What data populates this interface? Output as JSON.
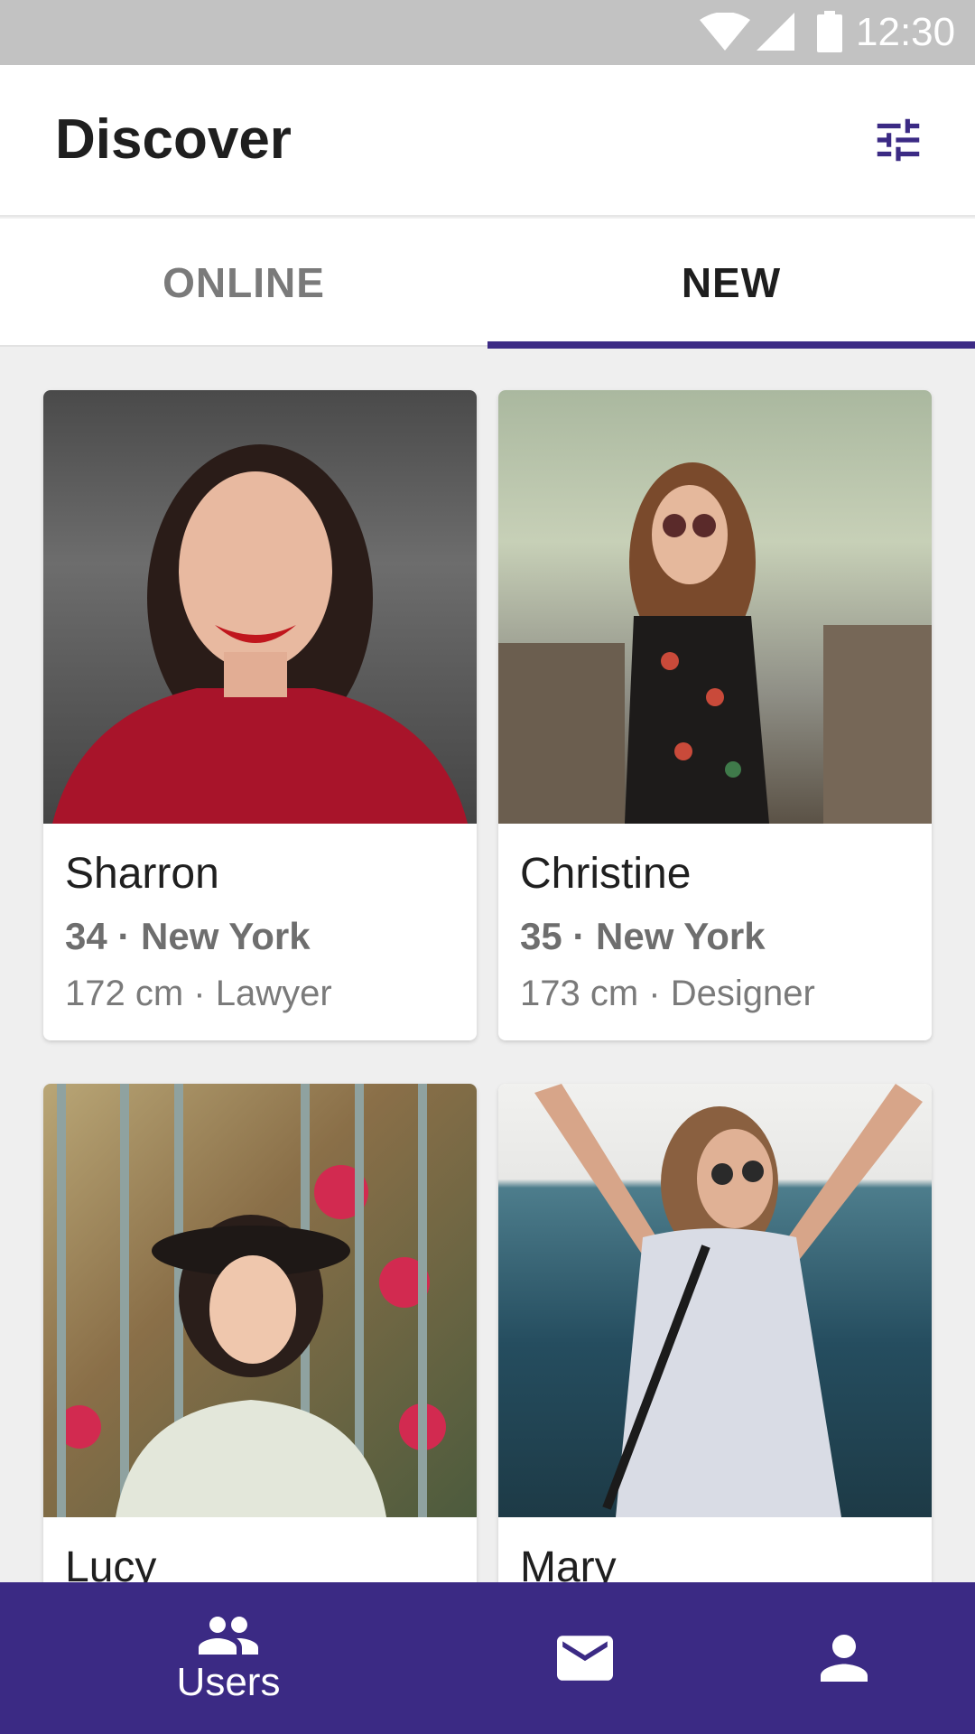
{
  "status_bar": {
    "time": "12:30",
    "icons": [
      "wifi-icon",
      "signal-icon",
      "battery-icon"
    ]
  },
  "header": {
    "title": "Discover",
    "filter_icon": "tune-icon"
  },
  "tabs": [
    {
      "label": "ONLINE",
      "active": false
    },
    {
      "label": "NEW",
      "active": true
    }
  ],
  "users": [
    {
      "name": "Sharron",
      "age_city": "34 · New York",
      "details": "172 cm · Lawyer"
    },
    {
      "name": "Christine",
      "age_city": "35 · New York",
      "details": "173 cm · Designer"
    },
    {
      "name": "Lucy"
    },
    {
      "name": "Mary"
    }
  ],
  "bottom_nav": [
    {
      "label": "Users",
      "icon": "people-icon",
      "active": true
    },
    {
      "icon": "mail-icon"
    },
    {
      "icon": "person-icon"
    }
  ],
  "colors": {
    "accent": "#3b2a84",
    "background": "#efefef"
  }
}
